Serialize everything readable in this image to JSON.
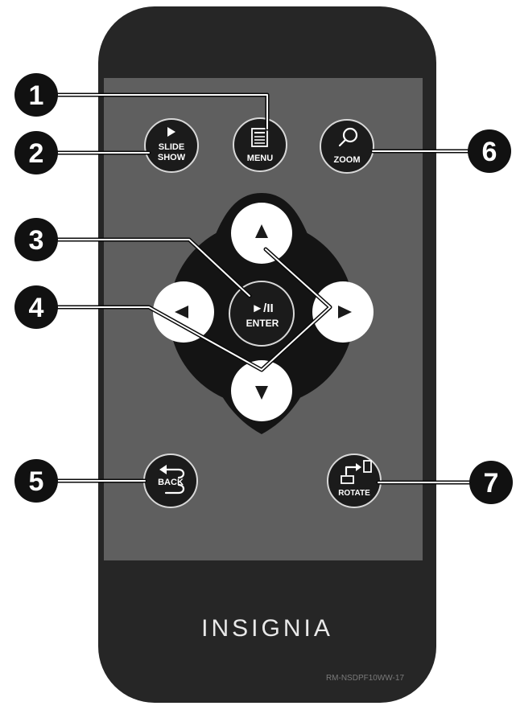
{
  "remote": {
    "brand": "INSIGNIA",
    "model": "RM-NSDPF10WW-17"
  },
  "buttons": {
    "slide_show": {
      "line1": "SLIDE",
      "line2": "SHOW"
    },
    "menu": {
      "label": "MENU"
    },
    "zoom": {
      "label": "ZOOM"
    },
    "enter": {
      "symbol": "►/II",
      "label": "ENTER"
    },
    "back": {
      "label": "BACK"
    },
    "rotate": {
      "label": "ROTATE"
    }
  },
  "callouts": [
    "1",
    "2",
    "3",
    "4",
    "5",
    "6",
    "7"
  ],
  "icons": {
    "slide_show": "play-icon",
    "menu": "menu-document-icon",
    "zoom": "magnifier-icon",
    "back": "back-arrow-icon",
    "rotate": "rotate-icon"
  },
  "colors": {
    "remote_body": "#262626",
    "panel": "#5f5f5f",
    "buttons": "#1b1b1b",
    "dpad_keys": "#ffffff"
  }
}
